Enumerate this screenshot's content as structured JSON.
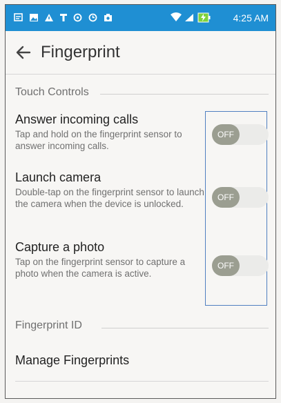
{
  "status_bar": {
    "left_icons": [
      "message-icon",
      "gallery-icon",
      "alert-icon",
      "data-icon",
      "sync-icon",
      "sync-alt-icon",
      "camera-icon"
    ],
    "right_icons": [
      "wifi-icon",
      "signal-icon",
      "battery-charging-icon"
    ],
    "time": "4:25 AM",
    "bar_color": "#1f8fd3"
  },
  "app_bar": {
    "title": "Fingerprint",
    "back_icon": "arrow-left-icon"
  },
  "sections": [
    {
      "header": "Touch Controls",
      "items": [
        {
          "title": "Answer incoming calls",
          "description": "Tap and hold on the fingerprint sensor to answer incoming calls.",
          "toggle_label": "OFF",
          "toggle_on": false
        },
        {
          "title": "Launch camera",
          "description": "Double-tap on the fingerprint sensor to launch the camera when the device is unlocked.",
          "toggle_label": "OFF",
          "toggle_on": false
        },
        {
          "title": "Capture a photo",
          "description": "Tap on the fingerprint sensor to capture a photo when the camera is active.",
          "toggle_label": "OFF",
          "toggle_on": false
        }
      ]
    },
    {
      "header": "Fingerprint ID",
      "items": [
        {
          "title": "Manage Fingerprints"
        }
      ]
    }
  ]
}
